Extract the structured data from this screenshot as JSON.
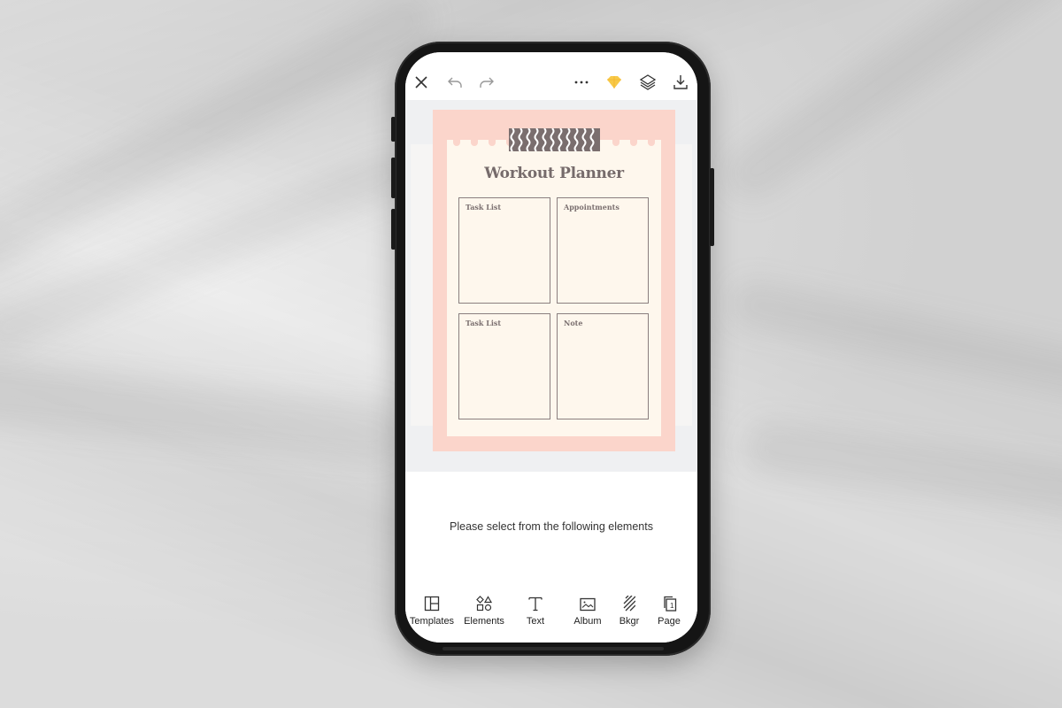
{
  "topbar": {
    "icons": [
      "close-icon",
      "undo-icon",
      "redo-icon",
      "more-icon",
      "premium-diamond-icon",
      "layers-icon",
      "download-icon"
    ],
    "accent_color": "#f7c948"
  },
  "design": {
    "title": "Workout Planner",
    "boxes": [
      {
        "label": "Task List"
      },
      {
        "label": "Appointments"
      },
      {
        "label": "Task List"
      },
      {
        "label": "Note"
      }
    ],
    "colors": {
      "frame": "#fbd5cb",
      "paper": "#fef7ed",
      "ink": "#766b6b"
    }
  },
  "sheet": {
    "message": "Please select from the following elements"
  },
  "toolbar": {
    "items": [
      {
        "label": "Templates",
        "icon": "templates-icon"
      },
      {
        "label": "Elements",
        "icon": "elements-icon"
      },
      {
        "label": "Text",
        "icon": "text-icon"
      },
      {
        "label": "Album",
        "icon": "album-icon"
      },
      {
        "label": "Bkgr",
        "icon": "background-icon"
      },
      {
        "label": "Page",
        "icon": "page-icon"
      }
    ],
    "page_number": "1"
  }
}
